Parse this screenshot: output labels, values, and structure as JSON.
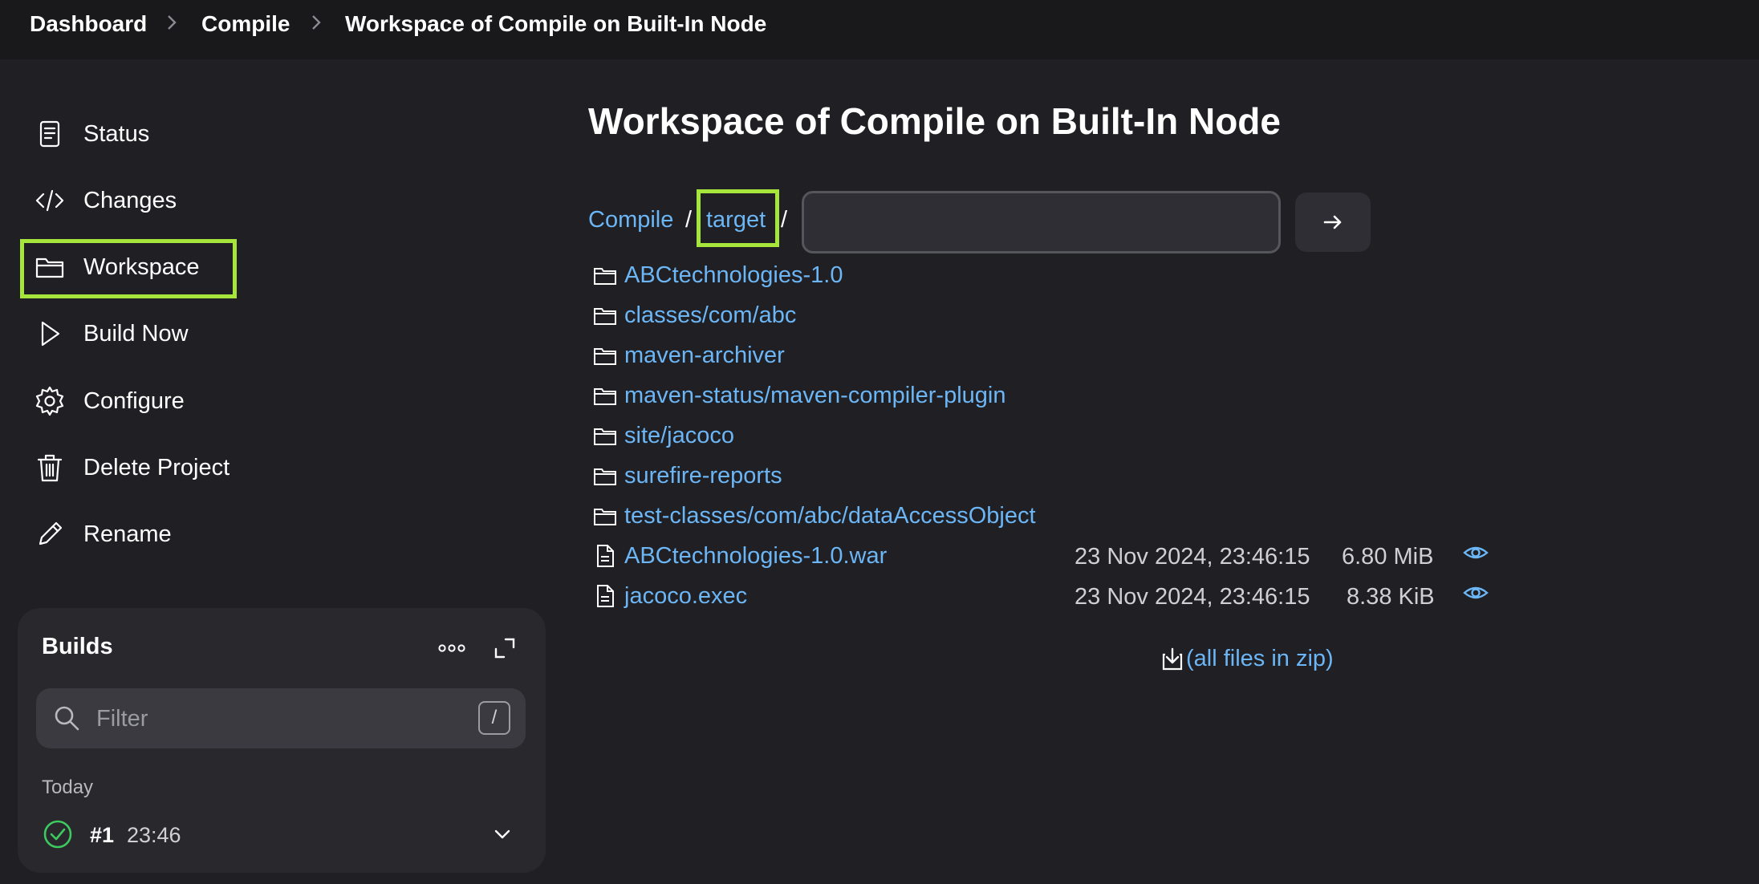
{
  "breadcrumb": [
    "Dashboard",
    "Compile",
    "Workspace of Compile on Built-In Node"
  ],
  "sidebar": {
    "items": [
      {
        "label": "Status",
        "icon": "document-icon"
      },
      {
        "label": "Changes",
        "icon": "code-icon"
      },
      {
        "label": "Workspace",
        "icon": "folder-icon"
      },
      {
        "label": "Build Now",
        "icon": "play-icon"
      },
      {
        "label": "Configure",
        "icon": "gear-icon"
      },
      {
        "label": "Delete Project",
        "icon": "trash-icon"
      },
      {
        "label": "Rename",
        "icon": "pencil-icon"
      }
    ],
    "active": "Workspace"
  },
  "main": {
    "title": "Workspace of Compile on Built-In Node",
    "path": {
      "root": "Compile",
      "sep": "/",
      "current": "target"
    },
    "path_input_value": "",
    "folders": [
      "ABCtechnologies-1.0",
      "classes/com/abc",
      "maven-archiver",
      "maven-status/maven-compiler-plugin",
      "site/jacoco",
      "surefire-reports",
      "test-classes/com/abc/dataAccessObject"
    ],
    "files": [
      {
        "name": "ABCtechnologies-1.0.war",
        "date": "23 Nov 2024, 23:46:15",
        "size": "6.80 MiB"
      },
      {
        "name": "jacoco.exec",
        "date": "23 Nov 2024, 23:46:15",
        "size": "8.38 KiB"
      }
    ],
    "zip_label": "(all files in zip)"
  },
  "builds": {
    "title": "Builds",
    "filter_placeholder": "Filter",
    "filter_shortcut": "/",
    "group_label": "Today",
    "items": [
      {
        "number": "#1",
        "time": "23:46",
        "status": "success"
      }
    ]
  },
  "colors": {
    "accent_link": "#6cb6f5",
    "highlight": "#a6e63c",
    "success": "#3ec95f"
  }
}
